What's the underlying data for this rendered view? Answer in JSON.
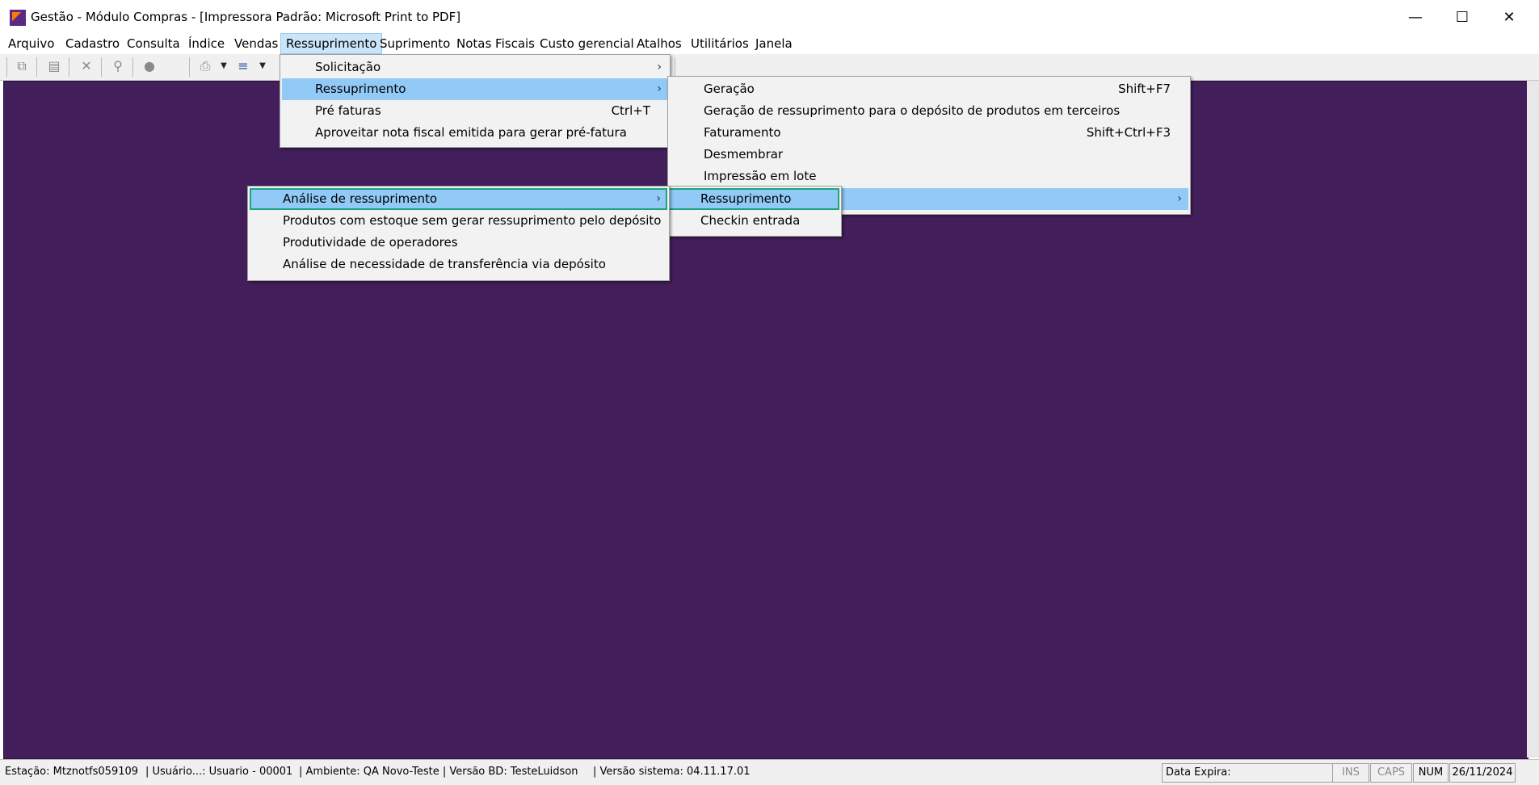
{
  "window": {
    "title": "Gestão  - Módulo Compras - [Impressora Padrão: Microsoft Print to PDF]",
    "icon": "app-logo-icon",
    "controls": {
      "minimize": "—",
      "maximize": "☐",
      "close": "✕"
    }
  },
  "menubar": {
    "items": [
      "Arquivo",
      "Cadastro",
      "Consulta",
      "Índice",
      "Vendas",
      "Ressuprimento",
      "Suprimento",
      "Notas Fiscais",
      "Custo gerencial",
      "Atalhos",
      "Utilitários",
      "Janela"
    ],
    "active": "Ressuprimento"
  },
  "menu_ressuprimento": {
    "items": [
      {
        "label": "Solicitação",
        "shortcut": "",
        "arrow": "›"
      },
      {
        "label": "Ressuprimento",
        "shortcut": "",
        "arrow": "›"
      },
      {
        "label": "Pré faturas",
        "shortcut": "Ctrl+T",
        "arrow": ""
      },
      {
        "label": "Aproveitar nota fiscal emitida para gerar pré-fatura",
        "shortcut": "",
        "arrow": ""
      }
    ]
  },
  "submenu_ressuprimento": {
    "items": [
      {
        "label": "Geração",
        "shortcut": "Shift+F7",
        "arrow": ""
      },
      {
        "label": "Geração de ressuprimento para o depósito de produtos em terceiros",
        "shortcut": "",
        "arrow": ""
      },
      {
        "label": "Faturamento",
        "shortcut": "Shift+Ctrl+F3",
        "arrow": ""
      },
      {
        "label": "Desmembrar",
        "shortcut": "",
        "arrow": ""
      },
      {
        "label": "Impressão em lote",
        "shortcut": "",
        "arrow": ""
      },
      {
        "label": "",
        "shortcut": "",
        "arrow": "›"
      }
    ]
  },
  "submenu_analise_parent": {
    "items": [
      {
        "label": "Ressuprimento",
        "shortcut": "",
        "arrow": ""
      },
      {
        "label": "Checkin entrada",
        "shortcut": "",
        "arrow": ""
      }
    ]
  },
  "submenu_analise": {
    "items": [
      {
        "label": "Análise de ressuprimento",
        "shortcut": "",
        "arrow": "›"
      },
      {
        "label": "Produtos com estoque sem gerar ressuprimento pelo depósito",
        "shortcut": "",
        "arrow": ""
      },
      {
        "label": "Produtividade de operadores",
        "shortcut": "",
        "arrow": ""
      },
      {
        "label": "Análise de necessidade de transferência via depósito",
        "shortcut": "",
        "arrow": ""
      }
    ]
  },
  "statusbar": {
    "estacao": "Estação: Mtznotfs059109",
    "usuario": "| Usuário...: Usuario - 00001",
    "ambiente": "| Ambiente: QA Novo-Teste | Versão BD: TesteLuidson",
    "versao": "| Versão sistema: 04.11.17.01",
    "data_expira": "Data Expira:",
    "ins": "INS",
    "caps": "CAPS",
    "num": "NUM",
    "date": "26/11/2024"
  },
  "colors": {
    "workspace": "#421e5a",
    "menu_highlight": "#91c9f7",
    "focus_box": "#1aa47a"
  }
}
